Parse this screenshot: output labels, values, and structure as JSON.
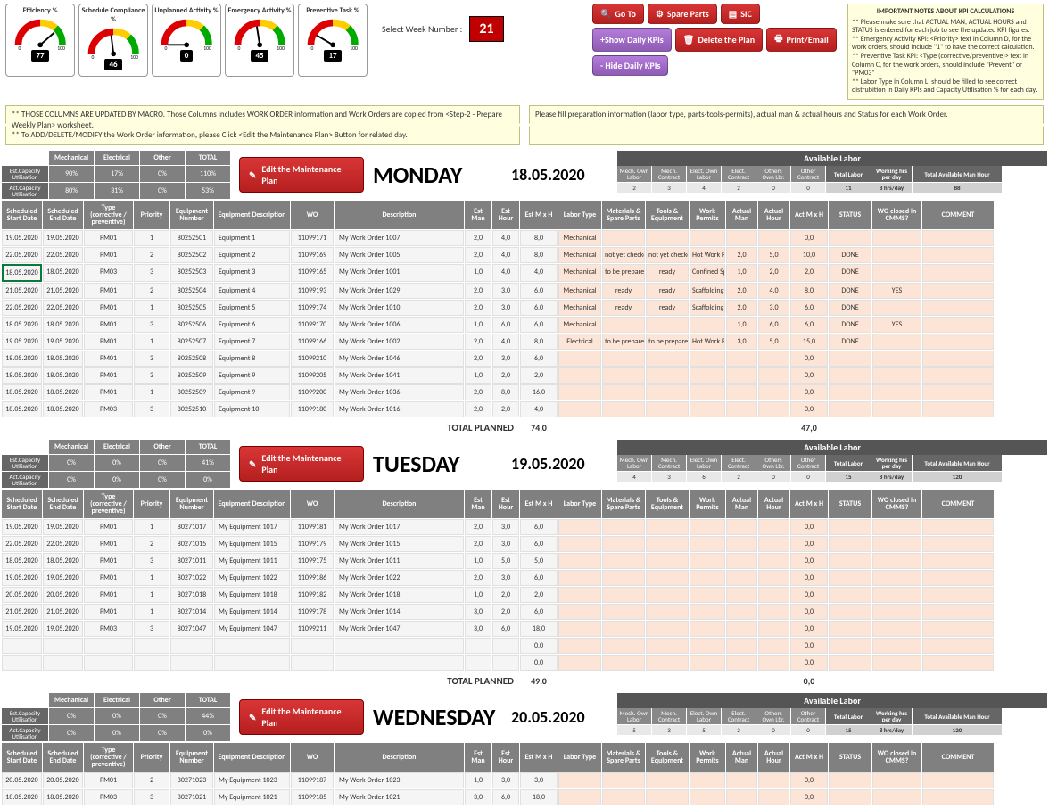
{
  "gauges": [
    {
      "title": "Efficiency %",
      "value": 77
    },
    {
      "title": "Schedule Compliance %",
      "value": 46
    },
    {
      "title": "Unplanned Activity %",
      "value": 0
    },
    {
      "title": "Emergency Activity %",
      "value": 45
    },
    {
      "title": "Preventive Task %",
      "value": 17
    }
  ],
  "weekLabel": "Select Week Number :",
  "weekNum": "21",
  "buttons": {
    "goto": "Go To",
    "spare": "Spare Parts",
    "sic": "SIC",
    "show": "+Show Daily KPIs",
    "delete": "Delete the Plan",
    "print": "Print/Email",
    "hide": "- Hide Daily KPIs"
  },
  "notes": {
    "title": "IMPORTANT NOTES ABOUT KPI CALCULATIONS",
    "l1": "** Please make sure that ACTUAL MAN, ACTUAL HOURS and STATUS is entered for each job to see the updated KPI figures.",
    "l2": "** Emergency Activity KPI: <Priority> text in Column D, for the work orders, should include \"1\" to have the correct calculation.",
    "l3": "** Preventive Task KPI: <Type (corrective/preventive)> text in Column C, for the work orders, should include \"Prevent\" or \"PM03\"",
    "l4": "** Labor Type in Column L, should be filled to see correct distrubition in Daily KPIs and Capacity Utilisation % for each day."
  },
  "infoLeft": {
    "l1": "** THOSE COLUMNS ARE UPDATED BY MACRO. Those Columns includes WORK ORDER information and Work Orders are copied from <Step-2 - Prepare Weekly Plan> worksheet.",
    "l2": "** To ADD/DELETE/MODIFY the Work Order information, please Click <Edit the Maintenance Plan> Button for related day."
  },
  "infoRight": {
    "l1": "Please fill preparation information (labor type, parts-tools-permits), actual man & actual hours and Status for each Work Order."
  },
  "editBtn": "Edit the Maintenance Plan",
  "sumHeaders": [
    "Mechanical",
    "Electrical",
    "Other",
    "TOTAL"
  ],
  "sumRows": [
    "Est.Capacity Utilisation",
    "Act.Capacity Utilisation"
  ],
  "availHead": "Available Labor",
  "availCols": [
    "Mech. Own Labor",
    "Mech. Contract",
    "Elect. Own Labor",
    "Elect. Contract",
    "Others Own Lbr.",
    "Other Contract",
    "Total Labor",
    "Working hrs per day",
    "Total Available Man Hour"
  ],
  "tableHeaders": [
    "Scheduled Start Date",
    "Scheduled End Date",
    "Type (corrective / preventive)",
    "Priority",
    "Equipment Number",
    "Equipment Description",
    "WO",
    "Description",
    "Est Man",
    "Est Hour",
    "Est M x H",
    "Labor Type",
    "Materials & Spare Parts",
    "Tools & Equipment",
    "Work Permits",
    "Actual Man",
    "Actual Hour",
    "Act M x H",
    "STATUS",
    "WO closed in CMMS?",
    "COMMENT"
  ],
  "totalLabel": "TOTAL PLANNED",
  "days": [
    {
      "name": "MONDAY",
      "date": "18.05.2020",
      "sum": [
        [
          "90%",
          "17%",
          "0%",
          "110%"
        ],
        [
          "80%",
          "31%",
          "0%",
          "53%"
        ]
      ],
      "avail": [
        "2",
        "3",
        "4",
        "2",
        "0",
        "0",
        "11",
        "8 hrs/day",
        "88"
      ],
      "totalEst": "74,0",
      "totalAct": "47,0",
      "rows": [
        [
          "19.05.2020",
          "19.05.2020",
          "PM01",
          "1",
          "80252501",
          "Equipment 1",
          "11099171",
          "My Work Order 1007",
          "2,0",
          "4,0",
          "8,0",
          "Mechanical",
          "",
          "",
          "",
          "",
          "",
          "0,0",
          "",
          "",
          ""
        ],
        [
          "22.05.2020",
          "22.05.2020",
          "PM01",
          "2",
          "80252502",
          "Equipment 2",
          "11099169",
          "My Work Order 1005",
          "2,0",
          "4,0",
          "8,0",
          "Mechanical",
          "not yet checked",
          "not yet checked",
          "Hot Work Permit",
          "2,0",
          "5,0",
          "10,0",
          "DONE",
          "",
          ""
        ],
        [
          "18.05.2020",
          "18.05.2020",
          "PM03",
          "3",
          "80252503",
          "Equipment 3",
          "11099165",
          "My Work Order 1001",
          "1,0",
          "4,0",
          "4,0",
          "Mechanical",
          "to be prepared",
          "ready",
          "Confined Spaces",
          "1,0",
          "2,0",
          "2,0",
          "DONE",
          "",
          ""
        ],
        [
          "21.05.2020",
          "21.05.2020",
          "PM01",
          "2",
          "80252504",
          "Equipment 4",
          "11099193",
          "My Work Order 1029",
          "2,0",
          "3,0",
          "6,0",
          "Mechanical",
          "ready",
          "ready",
          "Scaffolding/Heights",
          "2,0",
          "4,0",
          "8,0",
          "DONE",
          "YES",
          ""
        ],
        [
          "22.05.2020",
          "22.05.2020",
          "PM01",
          "1",
          "80252505",
          "Equipment 5",
          "11099174",
          "My Work Order 1010",
          "2,0",
          "3,0",
          "6,0",
          "Mechanical",
          "ready",
          "ready",
          "Scaffolding/Heights",
          "2,0",
          "3,0",
          "6,0",
          "DONE",
          "",
          ""
        ],
        [
          "18.05.2020",
          "18.05.2020",
          "PM01",
          "3",
          "80252506",
          "Equipment 6",
          "11099170",
          "My Work Order 1006",
          "1,0",
          "6,0",
          "6,0",
          "Mechanical",
          "",
          "",
          "",
          "1,0",
          "6,0",
          "6,0",
          "DONE",
          "YES",
          ""
        ],
        [
          "19.05.2020",
          "19.05.2020",
          "PM01",
          "1",
          "80252507",
          "Equipment 7",
          "11099166",
          "My Work Order 1002",
          "2,0",
          "4,0",
          "8,0",
          "Electrical",
          "to be prepared",
          "to be prepared",
          "Hot Work Permit",
          "3,0",
          "5,0",
          "15,0",
          "DONE",
          "",
          ""
        ],
        [
          "18.05.2020",
          "18.05.2020",
          "PM01",
          "3",
          "80252508",
          "Equipment 8",
          "11099210",
          "My Work Order 1046",
          "2,0",
          "3,0",
          "6,0",
          "",
          "",
          "",
          "",
          "",
          "",
          "0,0",
          "",
          "",
          ""
        ],
        [
          "18.05.2020",
          "18.05.2020",
          "PM01",
          "3",
          "80252509",
          "Equipment 9",
          "11099205",
          "My Work Order 1041",
          "1,0",
          "2,0",
          "2,0",
          "",
          "",
          "",
          "",
          "",
          "",
          "0,0",
          "",
          "",
          ""
        ],
        [
          "18.05.2020",
          "18.05.2020",
          "PM01",
          "1",
          "80252509",
          "Equipment 9",
          "11099200",
          "My Work Order 1036",
          "2,0",
          "8,0",
          "16,0",
          "",
          "",
          "",
          "",
          "",
          "",
          "0,0",
          "",
          "",
          ""
        ],
        [
          "18.05.2020",
          "18.05.2020",
          "PM03",
          "3",
          "80252510",
          "Equipment 10",
          "11099180",
          "My Work Order 1016",
          "2,0",
          "2,0",
          "4,0",
          "",
          "",
          "",
          "",
          "",
          "",
          "0,0",
          "",
          "",
          ""
        ]
      ]
    },
    {
      "name": "TUESDAY",
      "date": "19.05.2020",
      "sum": [
        [
          "0%",
          "0%",
          "0%",
          "41%"
        ],
        [
          "0%",
          "0%",
          "0%",
          "0%"
        ]
      ],
      "avail": [
        "4",
        "3",
        "6",
        "2",
        "0",
        "0",
        "15",
        "8 hrs/day",
        "120"
      ],
      "totalEst": "49,0",
      "totalAct": "0,0",
      "rows": [
        [
          "19.05.2020",
          "19.05.2020",
          "PM01",
          "1",
          "80271017",
          "My Equipment 1017",
          "11099181",
          "My Work Order 1017",
          "2,0",
          "3,0",
          "6,0",
          "",
          "",
          "",
          "",
          "",
          "",
          "0,0",
          "",
          "",
          ""
        ],
        [
          "22.05.2020",
          "22.05.2020",
          "PM01",
          "2",
          "80271015",
          "My Equipment 1015",
          "11099179",
          "My Work Order 1015",
          "2,0",
          "3,0",
          "6,0",
          "",
          "",
          "",
          "",
          "",
          "",
          "0,0",
          "",
          "",
          ""
        ],
        [
          "18.05.2020",
          "18.05.2020",
          "PM01",
          "3",
          "80271011",
          "My Equipment 1011",
          "11099175",
          "My Work Order 1011",
          "1,0",
          "5,0",
          "5,0",
          "",
          "",
          "",
          "",
          "",
          "",
          "0,0",
          "",
          "",
          ""
        ],
        [
          "19.05.2020",
          "19.05.2020",
          "PM01",
          "1",
          "80271022",
          "My Equipment 1022",
          "11099186",
          "My Work Order 1022",
          "2,0",
          "3,0",
          "6,0",
          "",
          "",
          "",
          "",
          "",
          "",
          "0,0",
          "",
          "",
          ""
        ],
        [
          "20.05.2020",
          "20.05.2020",
          "PM01",
          "1",
          "80271018",
          "My Equipment 1018",
          "11099182",
          "My Work Order 1018",
          "1,0",
          "2,0",
          "2,0",
          "",
          "",
          "",
          "",
          "",
          "",
          "0,0",
          "",
          "",
          ""
        ],
        [
          "21.05.2020",
          "21.05.2020",
          "PM01",
          "1",
          "80271014",
          "My Equipment 1014",
          "11099178",
          "My Work Order 1014",
          "3,0",
          "2,0",
          "6,0",
          "",
          "",
          "",
          "",
          "",
          "",
          "0,0",
          "",
          "",
          ""
        ],
        [
          "19.05.2020",
          "19.05.2020",
          "PM03",
          "3",
          "80271047",
          "My Equipment 1047",
          "11099211",
          "My Work Order 1047",
          "3,0",
          "6,0",
          "18,0",
          "",
          "",
          "",
          "",
          "",
          "",
          "0,0",
          "",
          "",
          ""
        ],
        [
          "",
          "",
          "",
          "",
          "",
          "",
          "",
          "",
          "",
          "",
          "0,0",
          "",
          "",
          "",
          "",
          "",
          "",
          "0,0",
          "",
          "",
          ""
        ],
        [
          "",
          "",
          "",
          "",
          "",
          "",
          "",
          "",
          "",
          "",
          "0,0",
          "",
          "",
          "",
          "",
          "",
          "",
          "0,0",
          "",
          "",
          ""
        ]
      ]
    },
    {
      "name": "WEDNESDAY",
      "date": "20.05.2020",
      "sum": [
        [
          "0%",
          "0%",
          "0%",
          "44%"
        ],
        [
          "0%",
          "0%",
          "0%",
          "0%"
        ]
      ],
      "avail": [
        "5",
        "3",
        "5",
        "2",
        "0",
        "0",
        "15",
        "8 hrs/day",
        "120"
      ],
      "totalEst": "",
      "totalAct": "",
      "rows": [
        [
          "20.05.2020",
          "20.05.2020",
          "PM01",
          "2",
          "80271023",
          "My Equipment 1023",
          "11099187",
          "My Work Order 1023",
          "1,0",
          "3,0",
          "3,0",
          "",
          "",
          "",
          "",
          "",
          "",
          "0,0",
          "",
          "",
          ""
        ],
        [
          "18.05.2020",
          "18.05.2020",
          "PM03",
          "3",
          "80271021",
          "My Equipment 1021",
          "11099185",
          "My Work Order 1021",
          "3,0",
          "6,0",
          "18,0",
          "",
          "",
          "",
          "",
          "",
          "",
          "0,0",
          "",
          "",
          ""
        ]
      ]
    }
  ]
}
